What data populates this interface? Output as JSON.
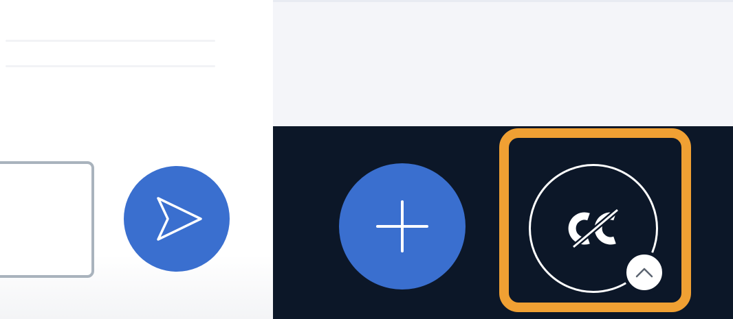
{
  "composer": {
    "message_value": "",
    "send_icon": "send-icon"
  },
  "call_toolbar": {
    "add_icon": "plus-icon",
    "captions_icon": "closed-captions-off-icon",
    "captions_state": "off",
    "captions_options_icon": "chevron-up-icon",
    "highlight_color": "#f0a033"
  },
  "colors": {
    "accent_blue": "#3a6fcf",
    "toolbar_background": "#0c1728",
    "input_border": "#a9b3bd"
  }
}
